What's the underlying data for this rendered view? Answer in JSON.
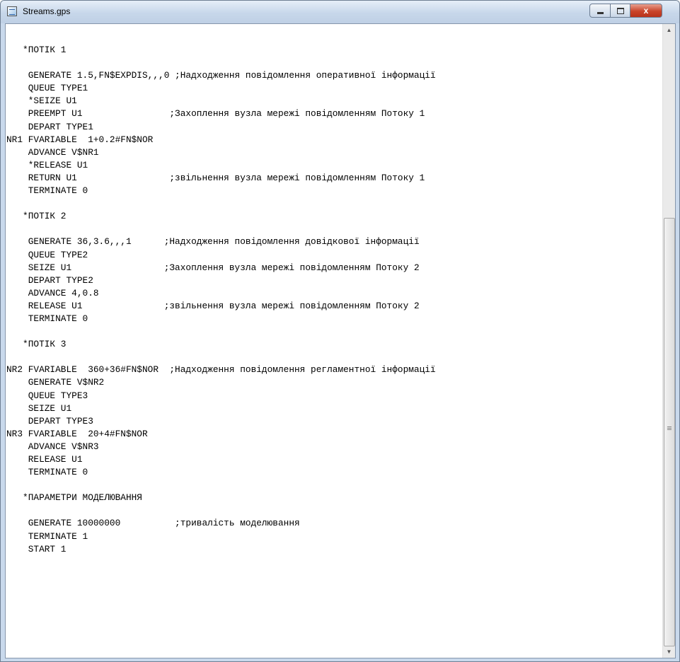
{
  "window": {
    "title": "Streams.gps",
    "min_label": "",
    "max_label": "",
    "close_label": "x"
  },
  "code_lines": [
    "   *ПОТІК 1",
    "",
    "    GENERATE 1.5,FN$EXPDIS,,,0 ;Надходження повідомлення оперативної інформації",
    "    QUEUE TYPE1",
    "    *SEIZE U1",
    "    PREEMPT U1                ;Захоплення вузла мережі повідомленням Потоку 1",
    "    DEPART TYPE1",
    "NR1 FVARIABLE  1+0.2#FN$NOR",
    "    ADVANCE V$NR1",
    "    *RELEASE U1",
    "    RETURN U1                 ;звільнення вузла мережі повідомленням Потоку 1",
    "    TERMINATE 0",
    "",
    "   *ПОТІК 2",
    "",
    "    GENERATE 36,3.6,,,1      ;Надходження повідомлення довідкової інформації",
    "    QUEUE TYPE2",
    "    SEIZE U1                 ;Захоплення вузла мережі повідомленням Потоку 2",
    "    DEPART TYPE2",
    "    ADVANCE 4,0.8",
    "    RELEASE U1               ;звільнення вузла мережі повідомленням Потоку 2",
    "    TERMINATE 0",
    "",
    "   *ПОТІК 3",
    "",
    "NR2 FVARIABLE  360+36#FN$NOR  ;Надходження повідомлення регламентної інформації",
    "    GENERATE V$NR2",
    "    QUEUE TYPE3",
    "    SEIZE U1",
    "    DEPART TYPE3",
    "NR3 FVARIABLE  20+4#FN$NOR",
    "    ADVANCE V$NR3",
    "    RELEASE U1",
    "    TERMINATE 0",
    "",
    "   *ПАРАМЕТРИ МОДЕЛЮВАННЯ",
    "",
    "    GENERATE 10000000          ;тривалість моделювання",
    "    TERMINATE 1",
    "    START 1"
  ],
  "scrollbar": {
    "up_arrow": "▲",
    "down_arrow": "▼",
    "position_fraction": 0.3,
    "visible_fraction": 0.7
  }
}
